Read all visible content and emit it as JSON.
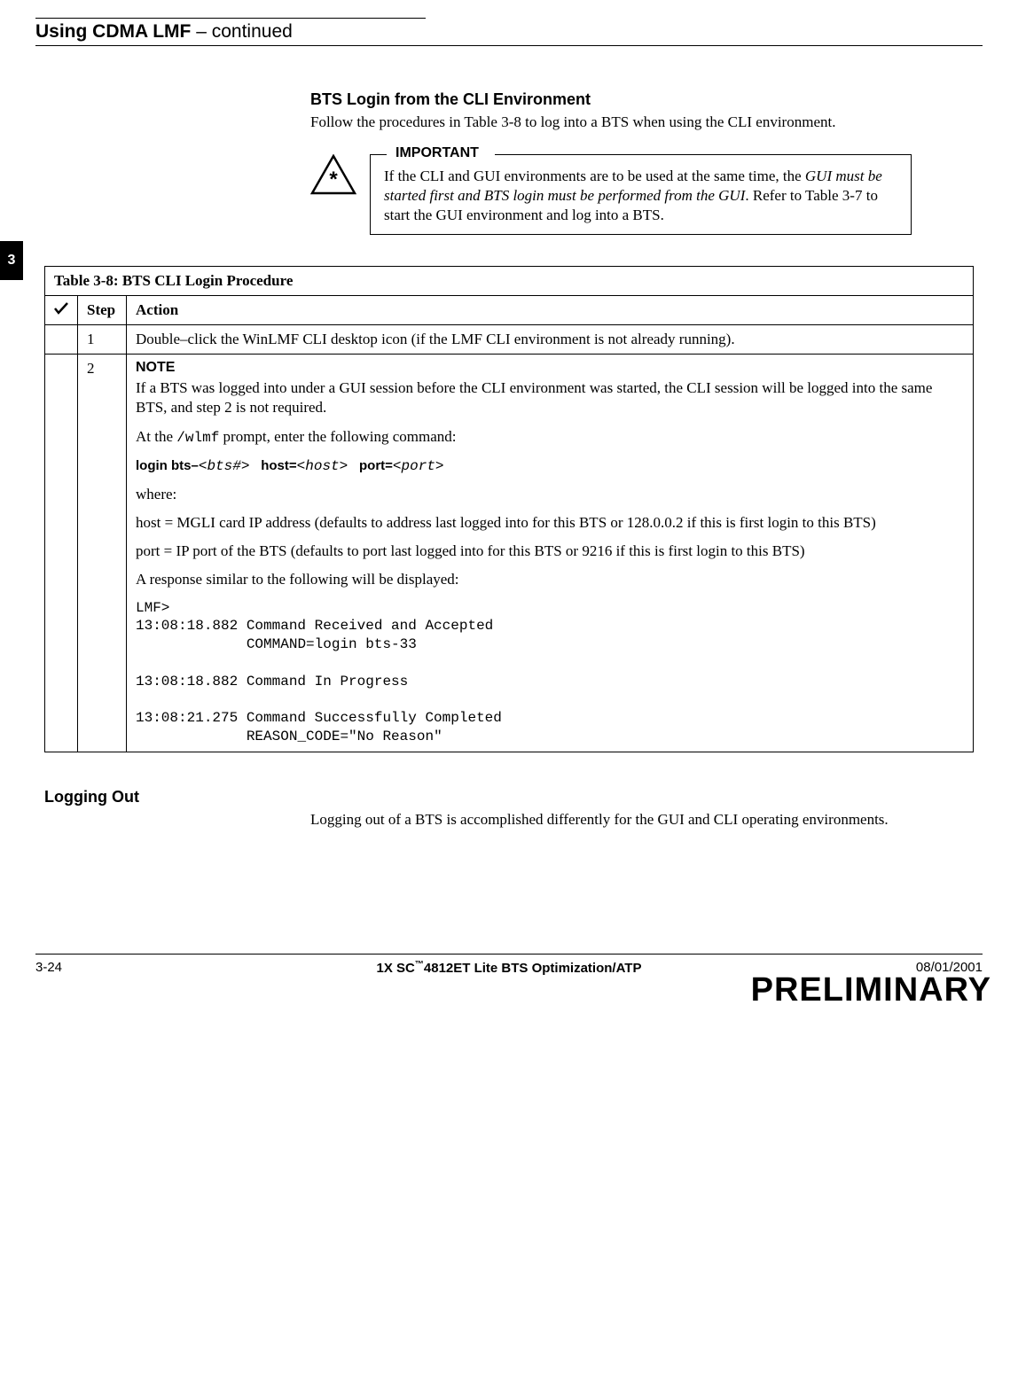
{
  "header": {
    "title_bold": "Using CDMA LMF",
    "title_suffix": " – continued"
  },
  "chapter_tab": "3",
  "section": {
    "heading": "BTS Login from the CLI Environment",
    "text": "Follow the procedures in Table 3-8 to log into a BTS when using the CLI environment."
  },
  "important": {
    "label": "IMPORTANT",
    "text_before": "If the CLI and GUI environments are to be used at the same time, the ",
    "text_italic": "GUI must be started first and BTS login must be performed from the GUI",
    "text_after": ". Refer to Table 3-7 to start the GUI environment and log into a BTS."
  },
  "table": {
    "caption_bold": "Table 3-8:",
    "caption_rest": " BTS CLI Login Procedure",
    "headers": {
      "step": "Step",
      "action": "Action"
    },
    "rows": [
      {
        "step": "1",
        "action_text": "Double–click the WinLMF CLI desktop icon (if the LMF CLI environment is not already running)."
      },
      {
        "step": "2",
        "note_label": "NOTE",
        "note_text": "If a BTS was logged into under a GUI session before the CLI environment was started, the CLI session will be logged into the same BTS, and step 2 is not required.",
        "prompt_line_before": "At the ",
        "prompt_code": "/wlmf",
        "prompt_line_after": " prompt, enter the following command:",
        "cmd_prefix": "login bts–",
        "cmd_arg1": "<bts#>",
        "cmd_host_label": "host=",
        "cmd_arg2": "<host>",
        "cmd_port_label": "port=",
        "cmd_arg3": "<port>",
        "where_label": "where:",
        "where_host": "host = MGLI card IP address (defaults to address last logged into for this BTS or 128.0.0.2 if this is first login to this BTS)",
        "where_port": "port = IP port of the BTS (defaults to port last logged into for this BTS or 9216 if this is first login to this BTS)",
        "response_intro": "A response similar to the following will be displayed:",
        "response_block": "LMF>\n13:08:18.882 Command Received and Accepted\n             COMMAND=login bts-33\n\n13:08:18.882 Command In Progress\n\n13:08:21.275 Command Successfully Completed\n             REASON_CODE=\"No Reason\""
      }
    ]
  },
  "subsection": {
    "heading": "Logging Out",
    "text": "Logging out of a BTS is accomplished differently for the GUI and CLI operating environments."
  },
  "footer": {
    "page": "3-24",
    "center_before": "1X SC",
    "center_tm": "™",
    "center_after": "4812ET Lite BTS Optimization/ATP",
    "date": "08/01/2001",
    "watermark": "PRELIMINARY"
  }
}
